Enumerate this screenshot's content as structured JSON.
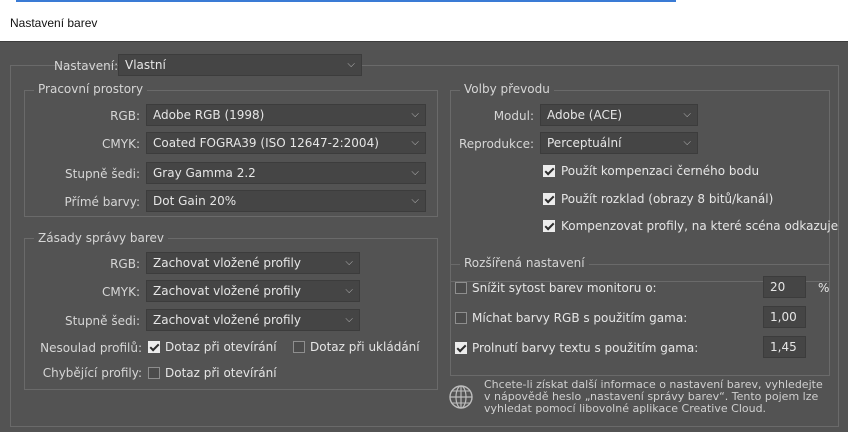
{
  "window": {
    "title": "Nastavení barev"
  },
  "settings": {
    "label": "Nastavení:",
    "value": "Vlastní"
  },
  "working_spaces": {
    "title": "Pracovní prostory",
    "rgb": {
      "label": "RGB:",
      "value": "Adobe RGB (1998)"
    },
    "cmyk": {
      "label": "CMYK:",
      "value": "Coated FOGRA39 (ISO 12647-2:2004)"
    },
    "gray": {
      "label": "Stupně šedi:",
      "value": "Gray Gamma 2.2"
    },
    "spot": {
      "label": "Přímé barvy:",
      "value": "Dot Gain 20%"
    }
  },
  "policies": {
    "title": "Zásady správy barev",
    "rgb": {
      "label": "RGB:",
      "value": "Zachovat vložené profily"
    },
    "cmyk": {
      "label": "CMYK:",
      "value": "Zachovat vložené profily"
    },
    "gray": {
      "label": "Stupně šedi:",
      "value": "Zachovat vložené profily"
    },
    "mismatch": {
      "label": "Nesoulad profilů:",
      "ask_open": "Dotaz při otevírání",
      "ask_open_checked": true,
      "ask_save": "Dotaz při ukládání",
      "ask_save_checked": false
    },
    "missing": {
      "label": "Chybějící profily:",
      "ask_open": "Dotaz při otevírání",
      "ask_open_checked": false
    }
  },
  "conversion": {
    "title": "Volby převodu",
    "engine": {
      "label": "Modul:",
      "value": "Adobe (ACE)"
    },
    "intent": {
      "label": "Reprodukce:",
      "value": "Perceptuální"
    },
    "bpc": {
      "text": "Použít kompenzaci černého bodu",
      "checked": true
    },
    "dither": {
      "text": "Použít rozklad (obrazy 8 bitů/kanál)",
      "checked": true
    },
    "compensate": {
      "text": "Kompenzovat profily, na které scéna odkazuje",
      "checked": true
    }
  },
  "advanced": {
    "title": "Rozšířená nastavení",
    "desaturate": {
      "text": "Snížit sytost barev monitoru o:",
      "checked": false,
      "value": "20",
      "unit": "%"
    },
    "blend_rgb": {
      "text": "Míchat barvy RGB s použitím gama:",
      "checked": false,
      "value": "1,00"
    },
    "blend_text": {
      "text": "Prolnutí barvy textu s použitím gama:",
      "checked": true,
      "value": "1,45"
    }
  },
  "info": {
    "line1": "Chcete-li získat další informace o nastavení barev, vyhledejte",
    "line2": "v nápovědě heslo „nastavení správy barev“. Tento pojem lze",
    "line3": "vyhledat pomocí libovolné aplikace Creative Cloud."
  }
}
